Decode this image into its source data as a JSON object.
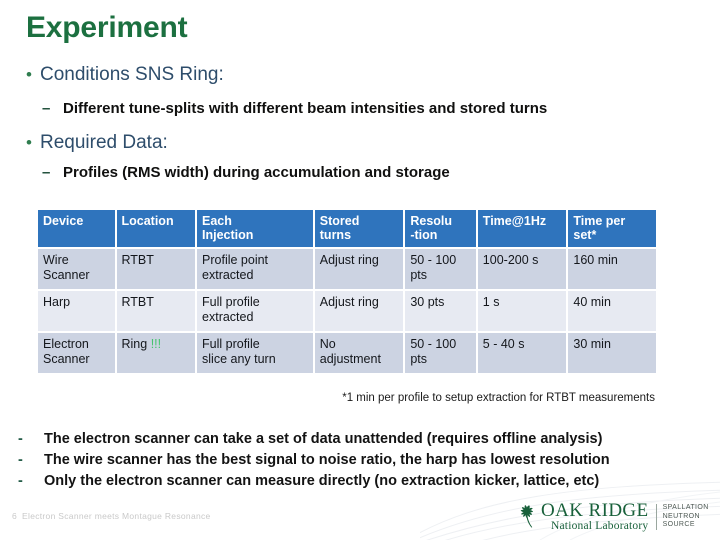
{
  "slide": {
    "title": "Experiment",
    "page_number": "6",
    "footer_text": "Electron Scanner meets Montague Resonance"
  },
  "bullets": [
    {
      "marker": "•",
      "text": "Conditions SNS Ring:"
    },
    {
      "marker": "–",
      "text": "Different tune-splits with different beam intensities and stored turns"
    },
    {
      "marker": "•",
      "text": "Required Data:"
    },
    {
      "marker": "–",
      "text": "Profiles (RMS width) during accumulation and storage"
    }
  ],
  "table": {
    "headers": [
      "Device",
      "Location",
      "Each Injection",
      "Stored turns",
      "Resolu -tion",
      "Time@1Hz",
      "Time per set*"
    ],
    "headers_lines": [
      [
        "Device"
      ],
      [
        "Location"
      ],
      [
        "Each",
        "Injection"
      ],
      [
        "Stored",
        "turns"
      ],
      [
        "Resolu",
        "-tion"
      ],
      [
        "Time@1Hz"
      ],
      [
        "Time per",
        "set*"
      ]
    ],
    "rows": [
      {
        "device": "Wire Scanner",
        "device_lines": [
          "Wire",
          "Scanner"
        ],
        "location": "RTBT",
        "location_suffix": "",
        "each_injection": "Profile point extracted",
        "each_injection_lines": [
          "Profile point",
          "extracted"
        ],
        "stored_turns": "Adjust ring",
        "resolution": "50 - 100 pts",
        "resolution_lines": [
          "50 - 100",
          "pts"
        ],
        "time_at_1hz": "100-200 s",
        "time_per_set": "160 min"
      },
      {
        "device": "Harp",
        "device_lines": [
          "Harp"
        ],
        "location": "RTBT",
        "location_suffix": "",
        "each_injection": "Full profile extracted",
        "each_injection_lines": [
          "Full profile",
          "extracted"
        ],
        "stored_turns": "Adjust ring",
        "resolution": "30 pts",
        "resolution_lines": [
          "30 pts"
        ],
        "time_at_1hz": "1 s",
        "time_per_set": "40 min"
      },
      {
        "device": "Electron Scanner",
        "device_lines": [
          "Electron",
          "Scanner"
        ],
        "location": "Ring",
        "location_suffix": "!!!",
        "each_injection": "Full profile slice any turn",
        "each_injection_lines": [
          "Full profile",
          "slice any turn"
        ],
        "stored_turns": "No adjustment",
        "stored_turns_lines": [
          "No",
          "adjustment"
        ],
        "resolution": "50 - 100 pts",
        "resolution_lines": [
          "50 - 100",
          "pts"
        ],
        "time_at_1hz": "5 - 40 s",
        "time_per_set": "30 min"
      }
    ],
    "footnote": "*1 min per profile to setup extraction for RTBT measurements"
  },
  "notes": [
    {
      "marker": "-",
      "text": "The electron scanner can take a set of data unattended (requires offline analysis)"
    },
    {
      "marker": "-",
      "text": "The wire scanner has the best signal to noise ratio, the harp has lowest resolution"
    },
    {
      "marker": "-",
      "text": "Only the electron scanner can measure directly (no extraction kicker, lattice, etc)"
    }
  ],
  "logo": {
    "line1": "OAK RIDGE",
    "line2": "National Laboratory",
    "sns_line1": "SPALLATION",
    "sns_line2": "NEUTRON",
    "sns_line3": "SOURCE"
  },
  "colors": {
    "title_green": "#1c7040",
    "bullet_blue": "#2e4d6b",
    "table_header_blue": "#2f74bd",
    "row_shade": "#ccd3e2",
    "row_light": "#e7eaf2",
    "exclaim_green": "#46c46e",
    "logo_green": "#18603a"
  }
}
